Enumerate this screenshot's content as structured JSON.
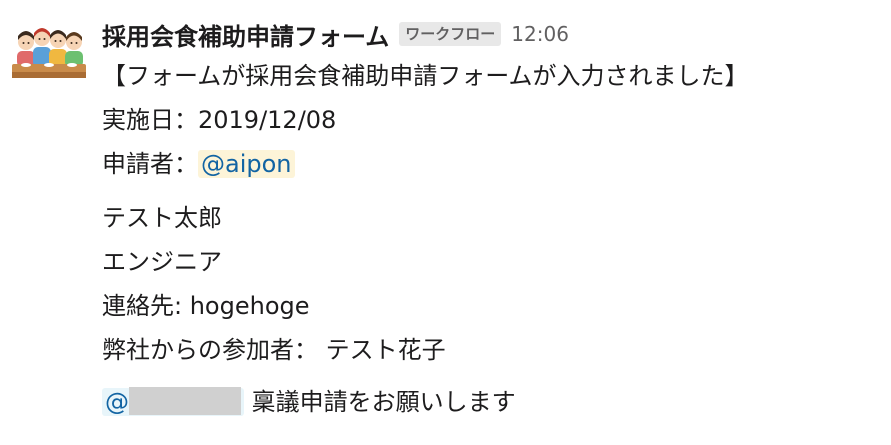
{
  "message": {
    "sender_name": "採用会食補助申請フォーム",
    "badge": "ワークフロー",
    "timestamp": "12:06",
    "title_line": "【フォームが採用会食補助申請フォームが入力されました】",
    "date_label": "実施日：",
    "date_value": "2019/12/08",
    "applicant_label": "申請者：",
    "applicant_mention": "@aipon",
    "candidate_name": "テスト太郎",
    "candidate_role": "エンジニア",
    "contact_label": "連絡先: ",
    "contact_value": "hogehoge",
    "attendee_label": "弊社からの参加者： ",
    "attendee_value": "テスト花子",
    "approver_mention_prefix": "@",
    "approval_request": " 稟議申請をお願いします"
  },
  "avatar": {
    "icon": "group-of-people-icon",
    "colors": {
      "skin": "#f6d4b5",
      "hair": "#3a2a1e",
      "shirt_1": "#e06a6a",
      "shirt_2": "#5aa0d8",
      "shirt_3": "#f0b840",
      "shirt_4": "#6cc070"
    }
  },
  "colors": {
    "mention_text": "#1264a3",
    "mention_bg_applicant": "#fdf4d8",
    "mention_bg_approver": "#e8f5fa",
    "timestamp": "#616061"
  }
}
